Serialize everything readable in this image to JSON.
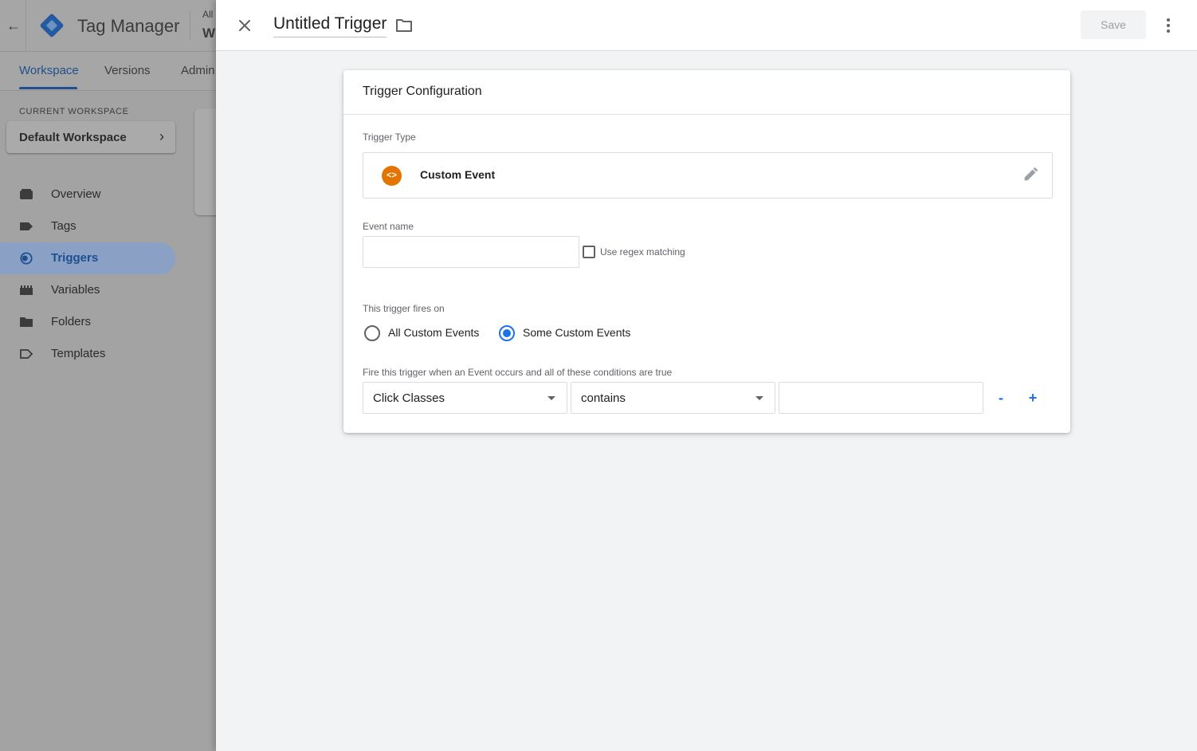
{
  "background_app": {
    "back_icon": "arrow-left-icon",
    "product_name": "Tag Manager",
    "account_line1": "All",
    "account_line2": "W",
    "tabs": [
      {
        "label": "Workspace",
        "active": true
      },
      {
        "label": "Versions",
        "active": false
      },
      {
        "label": "Admin",
        "active": false
      }
    ],
    "current_workspace_label": "CURRENT WORKSPACE",
    "workspace_name": "Default Workspace",
    "nav": [
      {
        "label": "Overview",
        "icon": "overview-icon",
        "active": false
      },
      {
        "label": "Tags",
        "icon": "tag-icon",
        "active": false
      },
      {
        "label": "Triggers",
        "icon": "trigger-icon",
        "active": true
      },
      {
        "label": "Variables",
        "icon": "variables-icon",
        "active": false
      },
      {
        "label": "Folders",
        "icon": "folder-icon",
        "active": false
      },
      {
        "label": "Templates",
        "icon": "template-icon",
        "active": false
      }
    ]
  },
  "editor": {
    "trigger_name": "Untitled Trigger",
    "save_label": "Save",
    "card": {
      "title": "Trigger Configuration",
      "trigger_type_label": "Trigger Type",
      "trigger_type": "Custom Event",
      "trigger_type_icon_glyph": "<>",
      "event_name_label": "Event name",
      "event_name_value": "",
      "regex_label": "Use regex matching",
      "regex_checked": false,
      "fires_on_label": "This trigger fires on",
      "fires_on_options": [
        {
          "label": "All Custom Events",
          "selected": false
        },
        {
          "label": "Some Custom Events",
          "selected": true
        }
      ],
      "conditions_label": "Fire this trigger when an Event occurs and all of these conditions are true",
      "condition": {
        "variable": "Click Classes",
        "operator": "contains",
        "value": ""
      },
      "remove_label": "-",
      "add_label": "+"
    }
  },
  "colors": {
    "accent": "#1a73e8",
    "custom_event_icon": "#e37400",
    "panel_bg": "#f1f3f4"
  }
}
